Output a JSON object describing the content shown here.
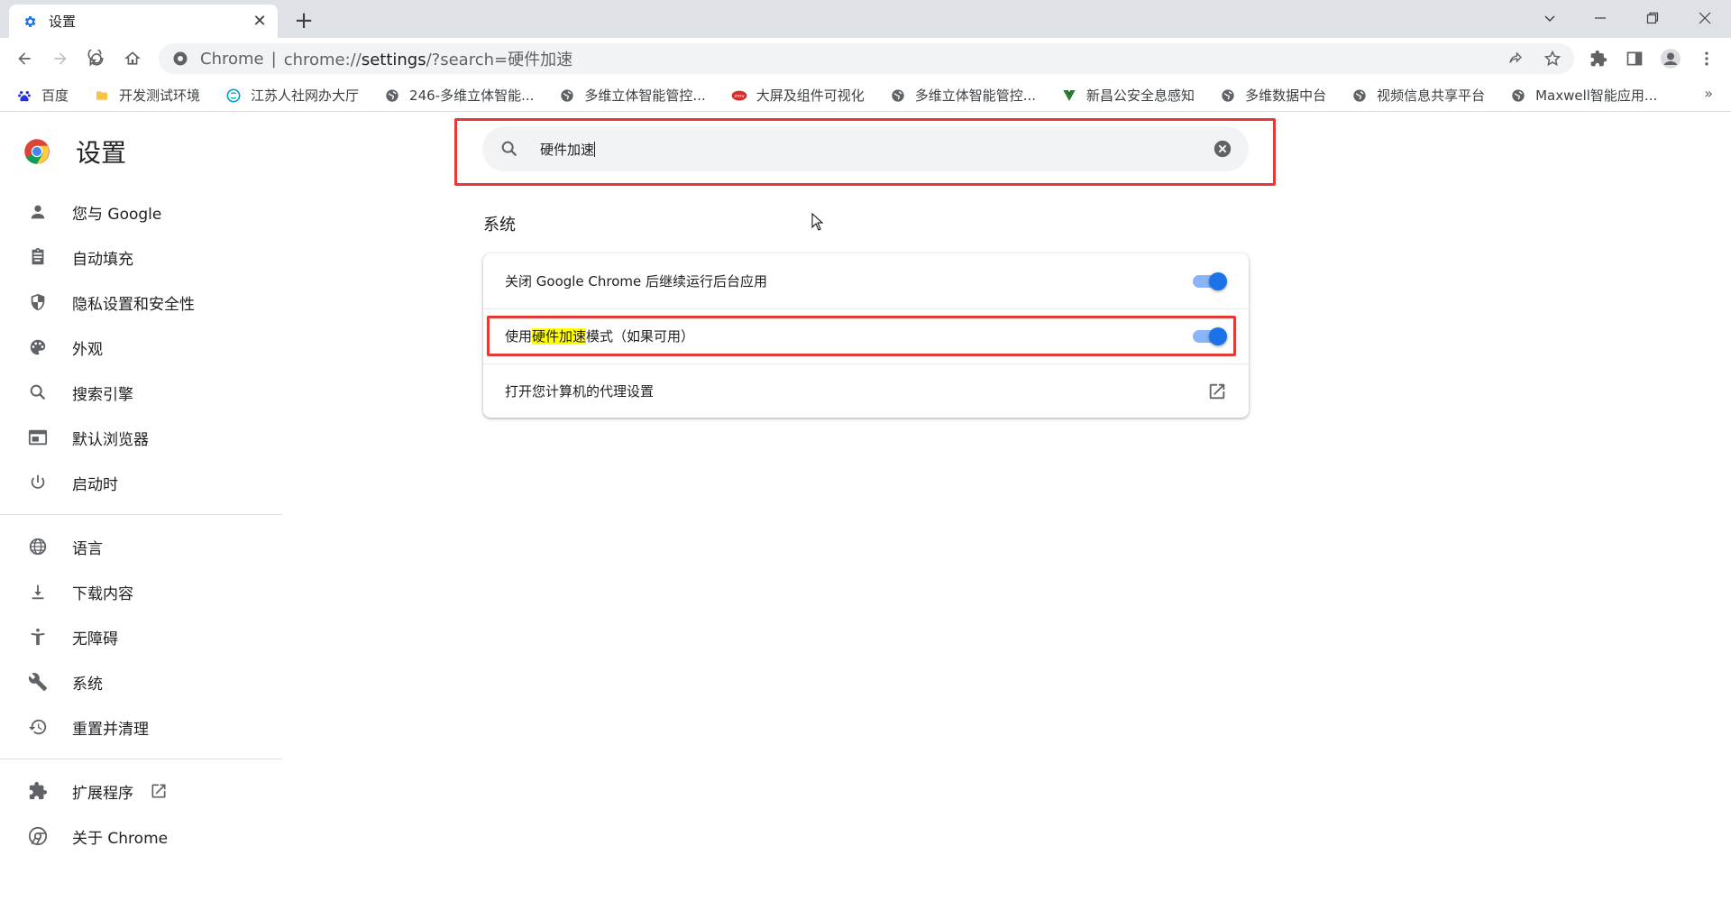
{
  "tab": {
    "title": "设置",
    "icon": "gear-icon"
  },
  "toolbar": {
    "url_host": "Chrome",
    "url_scheme_host": "chrome://",
    "url_bold": "settings",
    "url_rest": "/?search=硬件加速"
  },
  "bookmarks": [
    {
      "label": "百度",
      "icon": "baidu-icon",
      "color": "#2932e1"
    },
    {
      "label": "开发测试环境",
      "icon": "folder-icon",
      "color": "#f6c343"
    },
    {
      "label": "江苏人社网办大厅",
      "icon": "circle-logo-icon",
      "color": "#00a3c4"
    },
    {
      "label": "246-多维立体智能...",
      "icon": "globe-icon",
      "color": "#5f6368"
    },
    {
      "label": "多维立体智能管控...",
      "icon": "globe-icon",
      "color": "#5f6368"
    },
    {
      "label": "大屏及组件可视化",
      "icon": "zmv-icon",
      "color": "#d32f2f"
    },
    {
      "label": "多维立体智能管控...",
      "icon": "globe-icon",
      "color": "#5f6368"
    },
    {
      "label": "新昌公安全息感知",
      "icon": "vue-icon",
      "color": "#2e7d32"
    },
    {
      "label": "多维数据中台",
      "icon": "globe-icon",
      "color": "#5f6368"
    },
    {
      "label": "视频信息共享平台",
      "icon": "globe-icon",
      "color": "#5f6368"
    },
    {
      "label": "Maxwell智能应用...",
      "icon": "globe-icon",
      "color": "#5f6368"
    }
  ],
  "bookmarks_more": "»",
  "settings": {
    "title": "设置",
    "nav": [
      {
        "label": "您与 Google",
        "icon": "person-icon"
      },
      {
        "label": "自动填充",
        "icon": "clipboard-icon"
      },
      {
        "label": "隐私设置和安全性",
        "icon": "shield-icon"
      },
      {
        "label": "外观",
        "icon": "palette-icon"
      },
      {
        "label": "搜索引擎",
        "icon": "search-icon"
      },
      {
        "label": "默认浏览器",
        "icon": "browser-icon"
      },
      {
        "label": "启动时",
        "icon": "power-icon"
      }
    ],
    "nav2": [
      {
        "label": "语言",
        "icon": "globe-icon"
      },
      {
        "label": "下载内容",
        "icon": "download-icon"
      },
      {
        "label": "无障碍",
        "icon": "accessibility-icon"
      },
      {
        "label": "系统",
        "icon": "wrench-icon"
      },
      {
        "label": "重置并清理",
        "icon": "history-icon"
      }
    ],
    "nav3": [
      {
        "label": "扩展程序",
        "icon": "puzzle-icon"
      },
      {
        "label": "关于 Chrome",
        "icon": "chrome-icon"
      }
    ]
  },
  "search": {
    "value": "硬件加速"
  },
  "section": {
    "title": "系统",
    "rows": [
      {
        "label": "关闭 Google Chrome 后继续运行后台应用",
        "toggle_on": true
      },
      {
        "label_before": "使用",
        "label_highlight": "硬件加速",
        "label_after": "模式（如果可用）",
        "toggle_on": true
      },
      {
        "label": "打开您计算机的代理设置"
      }
    ]
  },
  "colors": {
    "accent": "#1a73e8",
    "highlight_box": "#e53935",
    "search_highlight": "#ffff00"
  }
}
